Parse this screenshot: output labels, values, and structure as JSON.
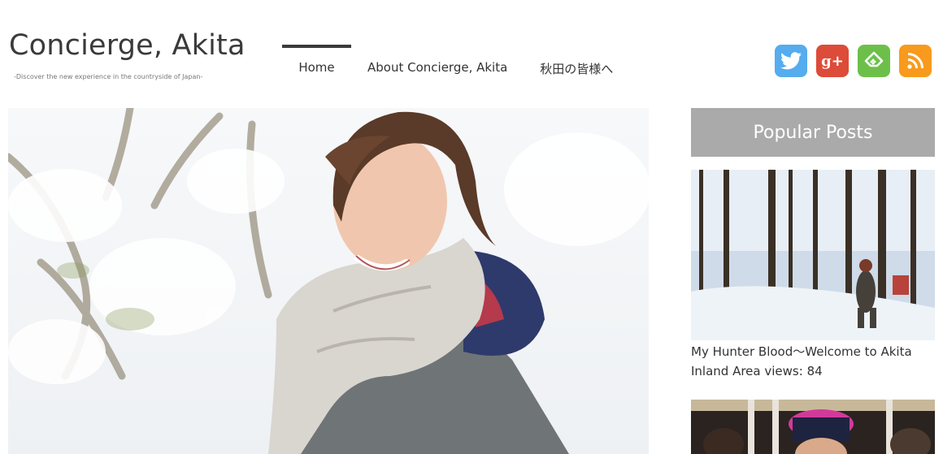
{
  "site": {
    "title": "Concierge, Akita",
    "description": "-Discover the new experience in the countryside of Japan-"
  },
  "nav": {
    "items": [
      {
        "label": "Home",
        "active": true
      },
      {
        "label": "About Concierge, Akita",
        "active": false
      },
      {
        "label": "秋田の皆様へ",
        "active": false
      }
    ]
  },
  "social": {
    "icons": [
      "twitter-icon",
      "google-plus-icon",
      "feedly-icon",
      "rss-icon"
    ],
    "gplus_text": "g+",
    "colors": {
      "twitter": "#55acee",
      "google_plus": "#dd4b39",
      "feedly": "#6cc04a",
      "rss": "#f89a1d"
    }
  },
  "hero": {
    "image": "woman-smiling-in-snow-photo"
  },
  "sidebar": {
    "heading": "Popular Posts",
    "posts": [
      {
        "title": "My Hunter Blood〜Welcome to Akita Inland Area",
        "views": "views: 84",
        "image": "hunters-in-snowy-forest-photo"
      },
      {
        "image": "people-in-winter-hats-photo"
      }
    ]
  }
}
